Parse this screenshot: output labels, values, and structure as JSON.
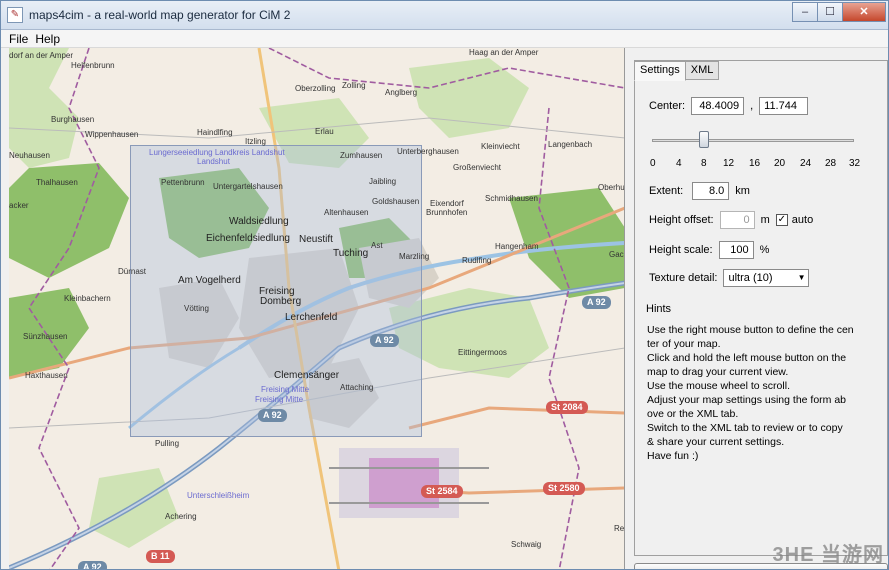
{
  "window": {
    "title": "maps4cim - a real-world map generator for CiM 2",
    "icon": "app-icon"
  },
  "menu": {
    "file": "File",
    "help": "Help"
  },
  "tabs": {
    "settings": "Settings",
    "xml": "XML"
  },
  "form": {
    "center_label": "Center:",
    "center_lat": "48.4009",
    "center_sep": ",",
    "center_lon": "11.744",
    "zoom_ticks": [
      "0",
      "4",
      "8",
      "12",
      "16",
      "20",
      "24",
      "28",
      "32"
    ],
    "zoom_value": 8,
    "zoom_max": 32,
    "extent_label": "Extent:",
    "extent_value": "8.0",
    "extent_unit": "km",
    "height_offset_label": "Height offset:",
    "height_offset_value": "0",
    "height_offset_unit": "m",
    "auto_label": "auto",
    "auto_checked": true,
    "height_scale_label": "Height scale:",
    "height_scale_value": "100",
    "height_scale_unit": "%",
    "texture_label": "Texture detail:",
    "texture_value": "ultra (10)"
  },
  "hints": {
    "title": "Hints",
    "lines": [
      "Use the right mouse button to define the cen",
      "ter of your map.",
      "Click and hold the left mouse button on the",
      "map to drag your current view.",
      "Use the mouse wheel to scroll.",
      "Adjust your map settings using the form ab",
      "ove or the XML tab.",
      "Switch to the XML tab to review or to copy",
      "& share your current settings.",
      "Have fun :)"
    ]
  },
  "map": {
    "labels": [
      "dorf an der Amper",
      "Helfenbrunn",
      "Oberzolling",
      "Zolling",
      "Anglberg",
      "Haag an der Amper",
      "Burghausen",
      "Wippenhausen",
      "Haindlfing",
      "Itzling",
      "Erlau",
      "Kleinviecht",
      "Langenbach",
      "Neuhausen",
      "Zumhausen",
      "Unterberghausen",
      "Großenviecht",
      "Pettenbrunn",
      "Untergartelshausen",
      "Thalhausen",
      "Jaibling",
      "Oberhu",
      "Goldshausen",
      "Eixendorf",
      "Schmidhausen",
      "acker",
      "Brunnhofen",
      "Altenhausen",
      "Waldsiedlung",
      "Neustift",
      "Eichenfeldsiedlung",
      "Ast",
      "Hangenham",
      "Tuching",
      "Marzling",
      "Gac",
      "Dürnast",
      "Rudlfing",
      "Am Vogelherd",
      "Freising",
      "Domberg",
      "Kleinbachern",
      "Vötting",
      "Lerchenfeld",
      "Sünzhausen",
      "Eittingermoos",
      "Haxthausen",
      "Clemensänger",
      "Attaching",
      "Pulling",
      "Achering",
      "Schwaig",
      "Re"
    ],
    "blue_labels": [
      "Freising Mitte",
      "Freising Mitte",
      "Lungerseeiedlung Landkreis Landshut",
      "Landshut",
      "Unterschleißheim"
    ],
    "shields": [
      "A 92",
      "A 92",
      "A 92",
      "St 2084",
      "St 2584",
      "St 2580",
      "B 11",
      "A 92"
    ]
  },
  "watermark": "3HE 当游网",
  "colors": {
    "water": "#9cc3e4",
    "forest": "#8fbf6a",
    "residential": "#d8d2c8",
    "boundary": "#a05ca0",
    "road": "#e8a87c",
    "highway": "#7b9ac0",
    "selection": "#aabedc"
  }
}
